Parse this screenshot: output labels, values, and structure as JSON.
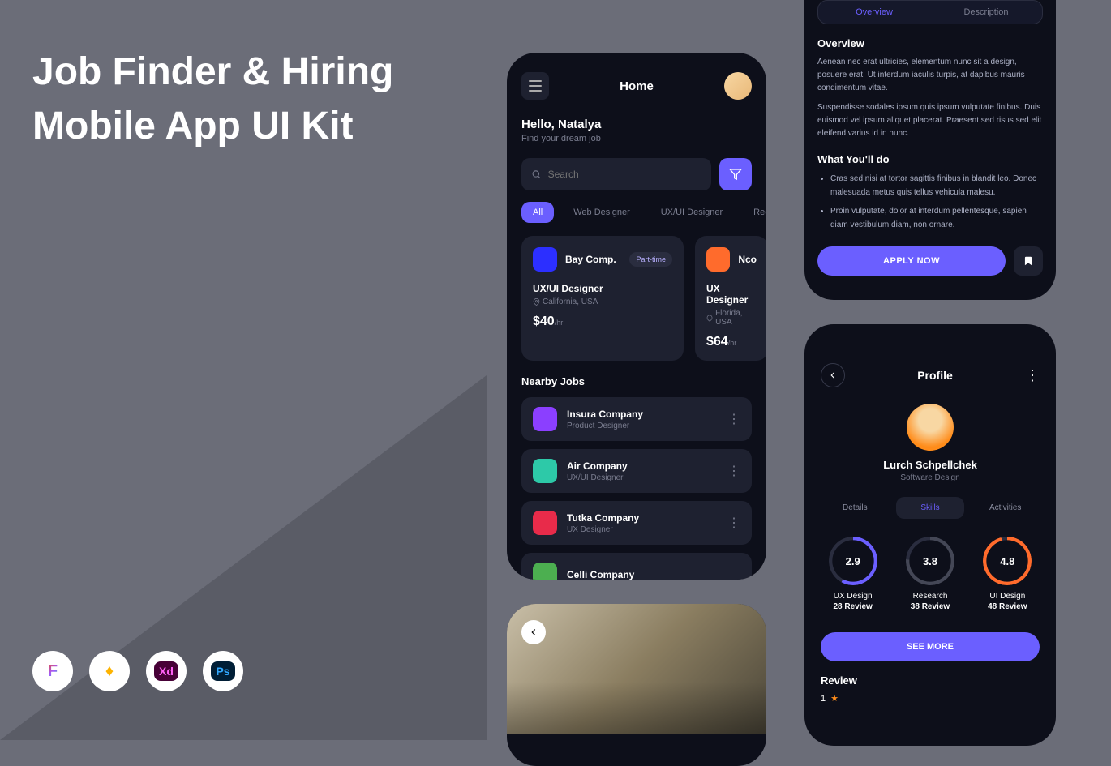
{
  "heading": "Job Finder & Hiring\nMobile App UI Kit",
  "tools": {
    "figma": "F",
    "sketch": "♦",
    "xd": "Xd",
    "ps": "Ps"
  },
  "home": {
    "title": "Home",
    "greeting": "Hello, Natalya",
    "subtitle": "Find your dream job",
    "searchPlaceholder": "Search",
    "chips": [
      "All",
      "Web Designer",
      "UX/UI Designer",
      "Recomm"
    ],
    "cards": [
      {
        "company": "Bay Comp.",
        "badge": "Part-time",
        "title": "UX/UI Designer",
        "location": "California, USA",
        "price": "$40",
        "per": "/hr"
      },
      {
        "company": "Nco",
        "title": "UX Designer",
        "location": "Florida, USA",
        "price": "$64",
        "per": "/hr"
      }
    ],
    "nearbyTitle": "Nearby Jobs",
    "nearby": [
      {
        "name": "Insura Company",
        "role": "Product Designer"
      },
      {
        "name": "Air Company",
        "role": "UX/UI Designer"
      },
      {
        "name": "Tutka Company",
        "role": "UX Designer"
      },
      {
        "name": "Celli Company",
        "role": ""
      }
    ]
  },
  "overview": {
    "tabs": [
      "Overview",
      "Description"
    ],
    "title1": "Overview",
    "text1": "Aenean nec erat ultricies, elementum nunc sit a design, posuere erat. Ut interdum iaculis turpis, at dapibus mauris condimentum vitae.",
    "text2": "Suspendisse sodales ipsum quis ipsum vulputate finibus. Duis euismod vel ipsum aliquet placerat. Praesent sed risus sed elit eleifend varius id in nunc.",
    "title2": "What You'll do",
    "bullets": [
      "Cras sed nisi at tortor sagittis finibus in blandit leo. Donec malesuada metus quis tellus vehicula malesu.",
      "Proin vulputate, dolor at interdum pellentesque, sapien diam vestibulum diam, non ornare."
    ],
    "applyBtn": "APPLY NOW"
  },
  "profile": {
    "title": "Profile",
    "name": "Lurch Schpellchek",
    "role": "Software Design",
    "tabs": [
      "Details",
      "Skills",
      "Activities"
    ],
    "skills": [
      {
        "value": "2.9",
        "name": "UX Design",
        "review": "28 Review"
      },
      {
        "value": "3.8",
        "name": "Research",
        "review": "38 Review"
      },
      {
        "value": "4.8",
        "name": "UI Design",
        "review": "48 Review"
      }
    ],
    "seeMore": "SEE MORE",
    "reviewTitle": "Review",
    "reviewNum": "1"
  }
}
